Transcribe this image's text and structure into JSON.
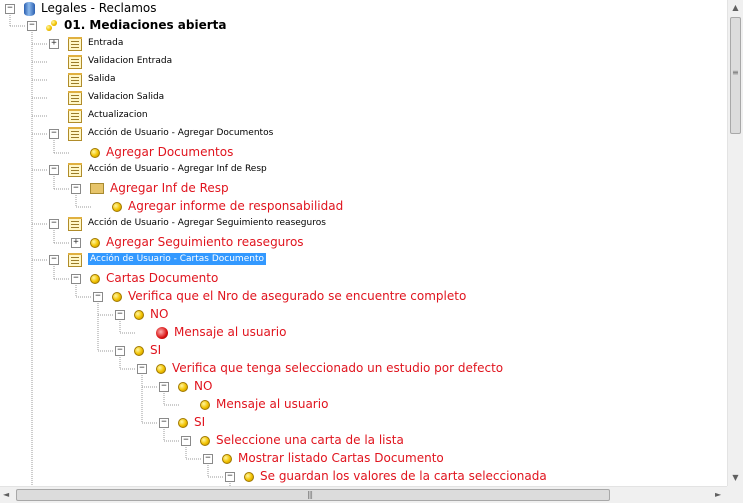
{
  "tree": {
    "nodes": [
      {
        "id": "n0",
        "label": "Legales -  Reclamos",
        "style": "root",
        "icon": "database-icon",
        "expander": "minus"
      },
      {
        "id": "n1",
        "label": "01. Mediaciones abierta",
        "style": "bold",
        "icon": "process-icon",
        "expander": "minus"
      },
      {
        "id": "n2",
        "label": "Entrada",
        "style": "small",
        "icon": "document-icon",
        "expander": "plus"
      },
      {
        "id": "n3",
        "label": "Validacion Entrada",
        "style": "small",
        "icon": "document-icon"
      },
      {
        "id": "n4",
        "label": "Salida",
        "style": "small",
        "icon": "document-icon"
      },
      {
        "id": "n5",
        "label": "Validacion Salida",
        "style": "small",
        "icon": "document-icon"
      },
      {
        "id": "n6",
        "label": "Actualizacion",
        "style": "small",
        "icon": "document-icon"
      },
      {
        "id": "n7",
        "label": "Acción de Usuario - Agregar Documentos",
        "style": "small",
        "icon": "document-icon",
        "expander": "minus"
      },
      {
        "id": "n8",
        "label": "Agregar Documentos",
        "style": "red",
        "icon": "circle-icon"
      },
      {
        "id": "n9",
        "label": "Acción de Usuario - Agregar Inf de Resp",
        "style": "small",
        "icon": "document-icon",
        "expander": "minus"
      },
      {
        "id": "n10",
        "label": "Agregar Inf de Resp",
        "style": "red",
        "icon": "folder-icon",
        "expander": "minus"
      },
      {
        "id": "n11",
        "label": "Agregar informe de responsabilidad",
        "style": "red",
        "icon": "circle-icon"
      },
      {
        "id": "n12",
        "label": "Acción de Usuario - Agregar Seguimiento reaseguros",
        "style": "small",
        "icon": "document-icon",
        "expander": "minus"
      },
      {
        "id": "n13",
        "label": "Agregar Seguimiento reaseguros",
        "style": "red",
        "icon": "circle-icon",
        "expander": "plus"
      },
      {
        "id": "n14",
        "label": "Acción de Usuario - Cartas Documento",
        "style": "small",
        "icon": "document-icon",
        "expander": "minus",
        "selected": true
      },
      {
        "id": "n15",
        "label": "Cartas Documento",
        "style": "red",
        "icon": "circle-icon",
        "expander": "minus"
      },
      {
        "id": "n16",
        "label": "Verifica que el Nro de asegurado se encuentre completo",
        "style": "red",
        "icon": "circle-icon",
        "expander": "minus"
      },
      {
        "id": "n17",
        "label": "NO",
        "style": "red",
        "icon": "circle-icon",
        "expander": "minus"
      },
      {
        "id": "n18",
        "label": "Mensaje al usuario",
        "style": "red",
        "icon": "message-gear-icon"
      },
      {
        "id": "n19",
        "label": "SI",
        "style": "red",
        "icon": "circle-icon",
        "expander": "minus"
      },
      {
        "id": "n20",
        "label": "Verifica que tenga seleccionado un estudio por defecto",
        "style": "red",
        "icon": "circle-icon",
        "expander": "minus"
      },
      {
        "id": "n21",
        "label": "NO",
        "style": "red",
        "icon": "circle-icon",
        "expander": "minus"
      },
      {
        "id": "n22",
        "label": "Mensaje al usuario",
        "style": "red",
        "icon": "circle-icon"
      },
      {
        "id": "n23",
        "label": "SI",
        "style": "red",
        "icon": "circle-icon",
        "expander": "minus"
      },
      {
        "id": "n24",
        "label": "Seleccione una carta de la lista",
        "style": "red",
        "icon": "circle-icon",
        "expander": "minus"
      },
      {
        "id": "n25",
        "label": "Mostrar listado Cartas Documento",
        "style": "red",
        "icon": "circle-icon",
        "expander": "minus"
      },
      {
        "id": "n26",
        "label": "Se guardan los valores de la carta seleccionada",
        "style": "red",
        "icon": "circle-icon",
        "expander": "minus"
      }
    ]
  },
  "scrollbars": {
    "vertical": {
      "up": "▲",
      "down": "▼",
      "grip": "≡"
    },
    "horizontal": {
      "left": "◄",
      "right": "►",
      "grip": "|||"
    }
  }
}
